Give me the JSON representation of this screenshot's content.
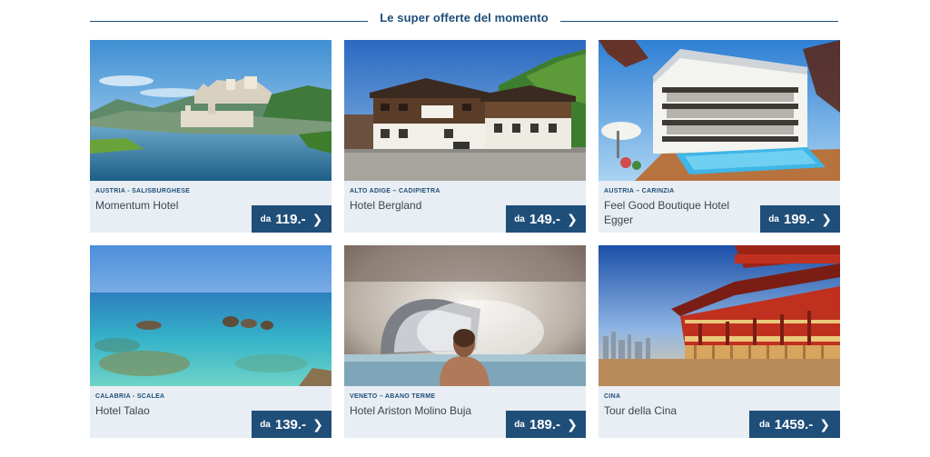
{
  "section": {
    "title": "Le super offerte del momento"
  },
  "offers": [
    {
      "region": "AUSTRIA - SALISBURGHESE",
      "name": "Momentum Hotel",
      "price_prefix": "da",
      "price": "119.-",
      "image": "salzburg-river-castle-photo"
    },
    {
      "region": "ALTO ADIGE – CADIPIETRA",
      "name": "Hotel Bergland",
      "price_prefix": "da",
      "price": "149.-",
      "image": "alpine-chalet-hotel-photo"
    },
    {
      "region": "AUSTRIA – CARINZIA",
      "name": "Feel Good Boutique Hotel Egger",
      "price_prefix": "da",
      "price": "199.-",
      "image": "hotel-pool-photo"
    },
    {
      "region": "CALABRIA - SCALEA",
      "name": "Hotel Talao",
      "price_prefix": "da",
      "price": "139.-",
      "image": "turquoise-sea-rocks-photo"
    },
    {
      "region": "VENETO – ABANO TERME",
      "name": "Hotel Ariston Molino Buja",
      "price_prefix": "da",
      "price": "189.-",
      "image": "thermal-pool-woman-photo"
    },
    {
      "region": "CINA",
      "name": "Tour della Cina",
      "price_prefix": "da",
      "price": "1459.-",
      "image": "chinese-pagoda-photo"
    }
  ],
  "icons": {
    "arrow": "chevron-right-icon"
  },
  "colors": {
    "brand": "#1f4e79",
    "card_bg": "#e8eef3",
    "text": "#3c4650"
  }
}
